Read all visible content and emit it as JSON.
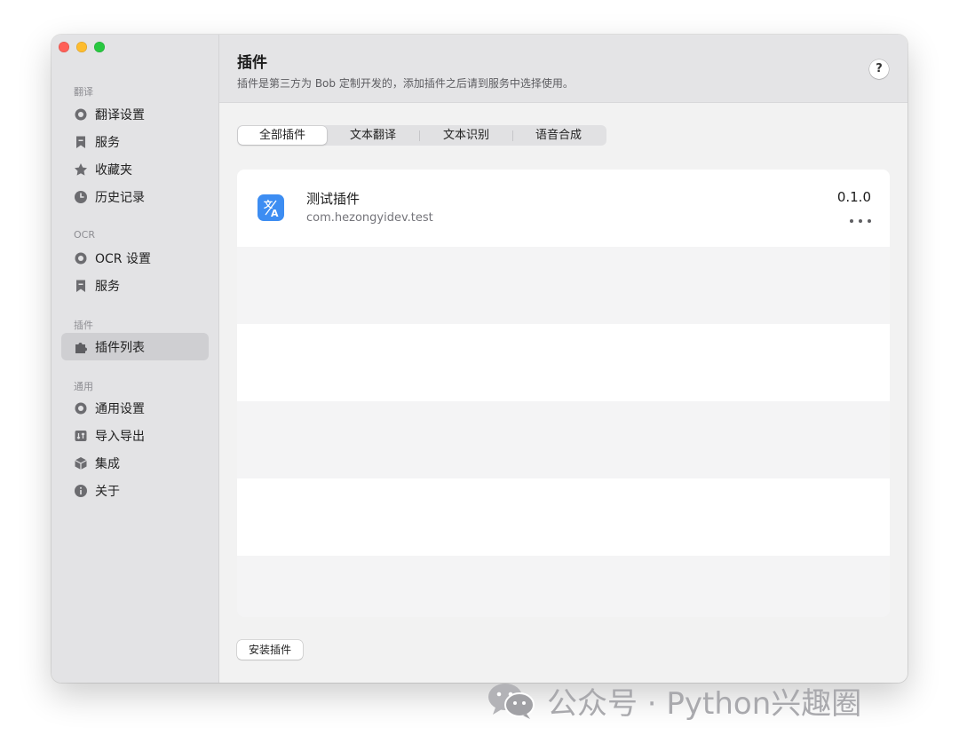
{
  "window": {
    "traffic_lights": {
      "close_color": "#ff5f57",
      "minimize_color": "#febc2e",
      "zoom_color": "#28c840"
    }
  },
  "sidebar": {
    "sections": [
      {
        "label": "翻译",
        "items": [
          {
            "label": "翻译设置",
            "icon": "gear-icon"
          },
          {
            "label": "服务",
            "icon": "bookmark-icon"
          },
          {
            "label": "收藏夹",
            "icon": "star-icon"
          },
          {
            "label": "历史记录",
            "icon": "clock-icon"
          }
        ]
      },
      {
        "label": "OCR",
        "items": [
          {
            "label": "OCR 设置",
            "icon": "gear-icon"
          },
          {
            "label": "服务",
            "icon": "bookmark-icon"
          }
        ]
      },
      {
        "label": "插件",
        "items": [
          {
            "label": "插件列表",
            "icon": "puzzle-icon",
            "selected": true
          }
        ]
      },
      {
        "label": "通用",
        "items": [
          {
            "label": "通用设置",
            "icon": "gear-icon"
          },
          {
            "label": "导入导出",
            "icon": "import-export-icon"
          },
          {
            "label": "集成",
            "icon": "cube-icon"
          },
          {
            "label": "关于",
            "icon": "info-icon"
          }
        ]
      }
    ]
  },
  "header": {
    "title": "插件",
    "subtitle": "插件是第三方为 Bob 定制开发的，添加插件之后请到服务中选择使用。",
    "help_label": "?"
  },
  "tabs": [
    {
      "label": "全部插件",
      "selected": true
    },
    {
      "label": "文本翻译",
      "selected": false
    },
    {
      "label": "文本识别",
      "selected": false
    },
    {
      "label": "语音合成",
      "selected": false
    }
  ],
  "plugins": [
    {
      "name": "测试插件",
      "identifier": "com.hezongyidev.test",
      "version": "0.1.0",
      "icon": "translate-icon",
      "icon_color": "#3d8df2"
    }
  ],
  "footer": {
    "install_label": "安装插件"
  },
  "watermark": {
    "text": "公众号 · Python兴趣圈",
    "icon": "wechat-icon"
  },
  "colors": {
    "sidebar_bg": "#e3e3e5",
    "selected_item_bg": "#cfcfd2",
    "main_bg": "#f2f2f2",
    "accent": "#3d8df2"
  }
}
